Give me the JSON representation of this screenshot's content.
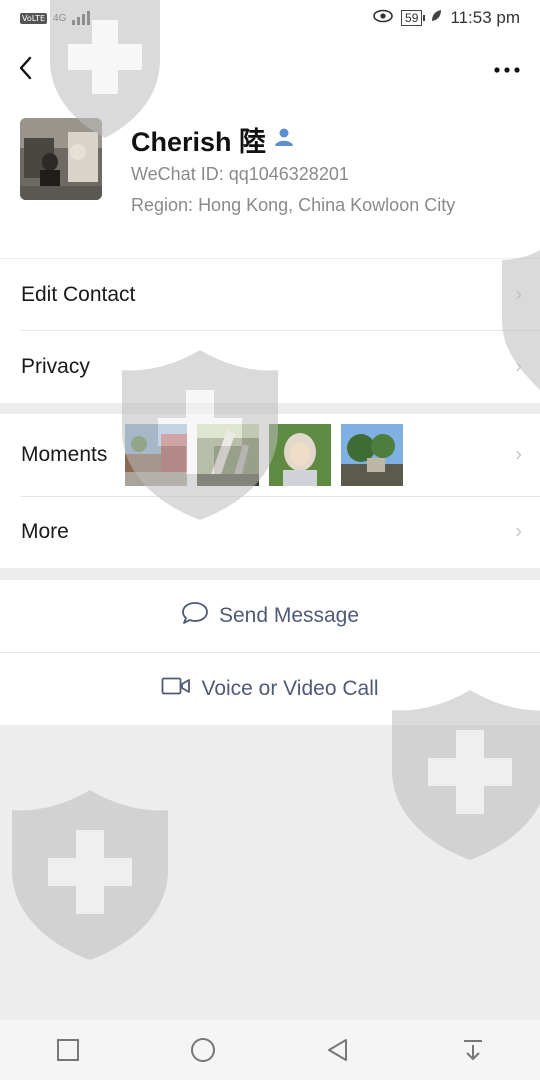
{
  "status_bar": {
    "network_badge": "VoLTE",
    "network_type": "4G",
    "battery": "59",
    "time": "11:53 pm"
  },
  "top_bar": {
    "back_icon": "chevron-left-icon",
    "more_icon": "more-dots-icon"
  },
  "profile": {
    "name": "Cherish 陸",
    "wechat_id_label": "WeChat ID:",
    "wechat_id": "qq1046328201",
    "region_label": "Region:",
    "region": "Hong Kong, China  Kowloon City"
  },
  "menu": {
    "edit_contact": "Edit Contact",
    "privacy": "Privacy",
    "moments": "Moments",
    "more": "More"
  },
  "actions": {
    "send_message": "Send Message",
    "voice_video_call": "Voice or Video Call"
  },
  "colors": {
    "accent": "#4f5a77",
    "contact_icon": "#5c8fd1",
    "page_bg": "#ededed"
  }
}
